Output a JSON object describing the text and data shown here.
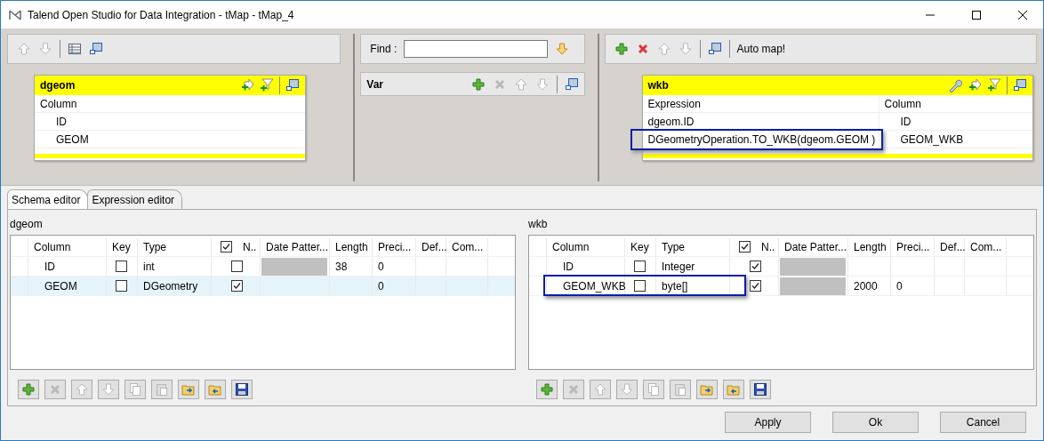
{
  "window": {
    "title": "Talend Open Studio for Data Integration - tMap - tMap_4"
  },
  "input_panel": {
    "toolbar": [
      {
        "kind": "up",
        "disabled": true
      },
      {
        "kind": "down",
        "disabled": true
      },
      {
        "kind": "table",
        "disabled": false
      },
      {
        "kind": "window",
        "disabled": false
      }
    ],
    "table": {
      "name": "dgeom",
      "tools": [
        {
          "kind": "add-out",
          "disabled": false
        },
        {
          "kind": "filter",
          "disabled": false
        },
        {
          "kind": "window",
          "disabled": false
        }
      ],
      "columns": [
        "Column"
      ],
      "rows": [
        {
          "cells": [
            "ID"
          ],
          "highlighted": false
        },
        {
          "cells": [
            "GEOM"
          ],
          "highlighted": false
        }
      ]
    }
  },
  "var_panel": {
    "find_label": "Find :",
    "var_table": {
      "name": "Var",
      "tools": [
        {
          "kind": "add",
          "disabled": false
        },
        {
          "kind": "delete",
          "disabled": true
        },
        {
          "kind": "up",
          "disabled": true
        },
        {
          "kind": "down",
          "disabled": true
        },
        {
          "kind": "window",
          "disabled": false
        }
      ]
    }
  },
  "output_panel": {
    "toolbar": [
      {
        "kind": "add",
        "disabled": false
      },
      {
        "kind": "delete",
        "disabled": false
      },
      {
        "kind": "up",
        "disabled": true
      },
      {
        "kind": "down",
        "disabled": true
      },
      {
        "kind": "window",
        "disabled": false
      }
    ],
    "auto_map": "Auto map!",
    "table": {
      "name": "wkb",
      "tools": [
        {
          "kind": "wrench",
          "disabled": false
        },
        {
          "kind": "add-out",
          "disabled": false
        },
        {
          "kind": "filter",
          "disabled": false
        },
        {
          "kind": "window",
          "disabled": false
        }
      ],
      "columns": [
        "Expression",
        "Column"
      ],
      "rows": [
        {
          "cells": [
            "dgeom.ID",
            "ID"
          ],
          "highlighted": false
        },
        {
          "cells": [
            "DGeometryOperation.TO_WKB(dgeom.GEOM )",
            "GEOM_WKB"
          ],
          "highlighted": true
        }
      ]
    }
  },
  "tabs": [
    {
      "label": "Schema editor",
      "selected": true
    },
    {
      "label": "Expression editor",
      "selected": false
    }
  ],
  "schemas": [
    {
      "title": "dgeom",
      "nullable_header_checked": true,
      "columns": [
        "Column",
        "Key",
        "Type",
        "N..",
        "Date Patter...",
        "Length",
        "Preci...",
        "Def...",
        "Com..."
      ],
      "rows": [
        {
          "column": "ID",
          "key": false,
          "type": "int",
          "nullable": false,
          "date_pattern_disabled": true,
          "length": "38",
          "precision": "0",
          "selected": false,
          "highlighted": false
        },
        {
          "column": "GEOM",
          "key": false,
          "type": "DGeometry",
          "nullable": true,
          "date_pattern_disabled": false,
          "precision": "0",
          "selected": true,
          "highlighted": false
        }
      ],
      "toolbar": [
        {
          "kind": "add",
          "disabled": false
        },
        {
          "kind": "delete",
          "disabled": true
        },
        {
          "kind": "up",
          "disabled": true
        },
        {
          "kind": "down",
          "disabled": true
        },
        {
          "kind": "copy",
          "disabled": true
        },
        {
          "kind": "paste",
          "disabled": true
        },
        {
          "kind": "import",
          "disabled": false
        },
        {
          "kind": "export",
          "disabled": false
        },
        {
          "kind": "save",
          "disabled": false
        }
      ]
    },
    {
      "title": "wkb",
      "nullable_header_checked": true,
      "columns": [
        "Column",
        "Key",
        "Type",
        "N..",
        "Date Patter...",
        "Length",
        "Preci...",
        "Def...",
        "Com..."
      ],
      "rows": [
        {
          "column": "ID",
          "key": false,
          "type": "Integer",
          "nullable": true,
          "date_pattern_disabled": true,
          "selected": false,
          "highlighted": false
        },
        {
          "column": "GEOM_WKB",
          "key": false,
          "type": "byte[]",
          "nullable": true,
          "date_pattern_disabled": true,
          "length": "2000",
          "precision": "0",
          "selected": false,
          "highlighted": true
        }
      ],
      "toolbar": [
        {
          "kind": "add",
          "disabled": false
        },
        {
          "kind": "delete",
          "disabled": true
        },
        {
          "kind": "up",
          "disabled": true
        },
        {
          "kind": "down",
          "disabled": true
        },
        {
          "kind": "copy",
          "disabled": true
        },
        {
          "kind": "paste",
          "disabled": true
        },
        {
          "kind": "import",
          "disabled": false
        },
        {
          "kind": "export",
          "disabled": false
        },
        {
          "kind": "save",
          "disabled": false
        }
      ]
    }
  ],
  "buttons": [
    "Apply",
    "Ok",
    "Cancel"
  ]
}
